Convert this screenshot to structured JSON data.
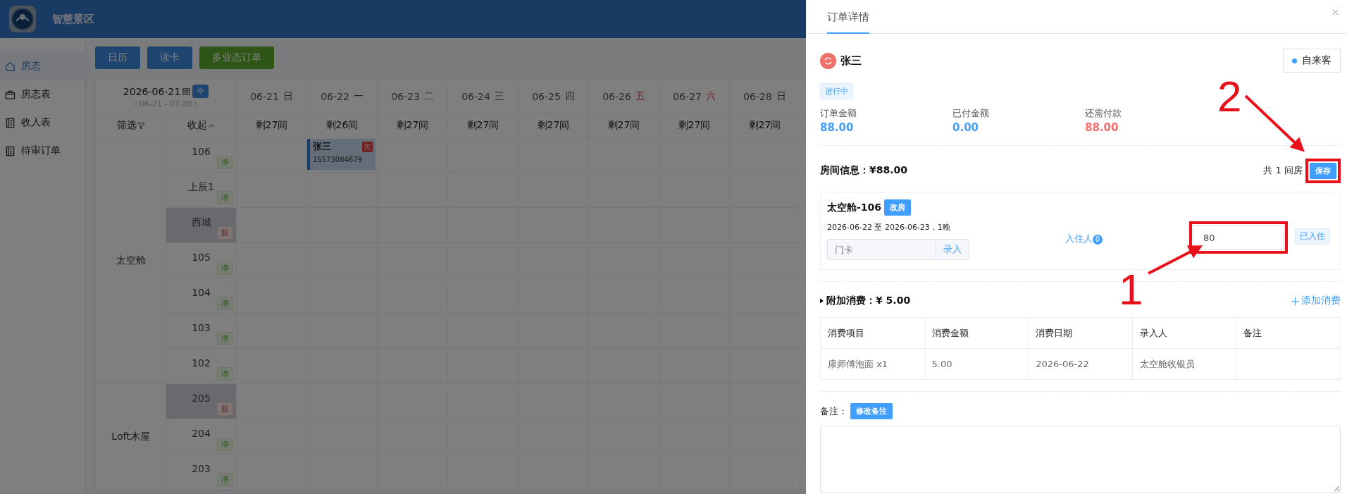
{
  "app": {
    "title": "智慧景区"
  },
  "sidebar": {
    "items": [
      {
        "label": "房态",
        "selected": true
      },
      {
        "label": "房态表",
        "selected": false
      },
      {
        "label": "收入表",
        "selected": false
      },
      {
        "label": "待审订单",
        "selected": false
      }
    ]
  },
  "toolbar": {
    "buttons": [
      {
        "label": "日历",
        "kind": "primary"
      },
      {
        "label": "读卡",
        "kind": "primary"
      },
      {
        "label": "多业态订单",
        "kind": "success"
      }
    ]
  },
  "calendar": {
    "date": "2026-06-21",
    "today_button": "今",
    "range": "06-21 - 07-20",
    "filter_label": "筛选",
    "collapse_label": "收起",
    "days": [
      {
        "date": "06-21",
        "weekday": "日",
        "highlight": false,
        "remaining": "剩27间"
      },
      {
        "date": "06-22",
        "weekday": "一",
        "highlight": false,
        "remaining": "剩26间"
      },
      {
        "date": "06-23",
        "weekday": "二",
        "highlight": false,
        "remaining": "剩27间"
      },
      {
        "date": "06-24",
        "weekday": "三",
        "highlight": false,
        "remaining": "剩27间"
      },
      {
        "date": "06-25",
        "weekday": "四",
        "highlight": false,
        "remaining": "剩27间"
      },
      {
        "date": "06-26",
        "weekday": "五",
        "highlight": true,
        "remaining": "剩27间"
      },
      {
        "date": "06-27",
        "weekday": "六",
        "highlight": true,
        "remaining": "剩27间"
      },
      {
        "date": "06-28",
        "weekday": "日",
        "highlight": false,
        "remaining": "剩27间"
      }
    ],
    "groups": [
      {
        "name": "太空舱",
        "rooms": [
          {
            "number": "106",
            "status": "净",
            "kind": "clean",
            "cells": [
              {
                "booked": false
              },
              {
                "booked": true,
                "name": "张三",
                "phone": "15573084679",
                "badge": "欠"
              },
              {
                "booked": false
              },
              {
                "booked": false
              },
              {
                "booked": false
              },
              {
                "booked": false
              },
              {
                "booked": false
              },
              {
                "booked": false
              }
            ]
          },
          {
            "number": "上辰1",
            "status": "净",
            "kind": "clean"
          },
          {
            "number": "西城",
            "status": "脏",
            "kind": "dirty"
          },
          {
            "number": "105",
            "status": "净",
            "kind": "clean"
          },
          {
            "number": "104",
            "status": "净",
            "kind": "clean"
          },
          {
            "number": "103",
            "status": "净",
            "kind": "clean"
          },
          {
            "number": "102",
            "status": "净",
            "kind": "clean"
          }
        ]
      },
      {
        "name": "Loft木屋",
        "rooms": [
          {
            "number": "205",
            "status": "脏",
            "kind": "dirty"
          },
          {
            "number": "204",
            "status": "净",
            "kind": "clean"
          },
          {
            "number": "203",
            "status": "净",
            "kind": "clean"
          }
        ]
      }
    ]
  },
  "drawer": {
    "tab": "订单详情",
    "guest_name": "张三",
    "source": "自来客",
    "status": "进行中",
    "amounts": [
      {
        "label": "订单金额",
        "value": "88.00",
        "kind": "total"
      },
      {
        "label": "已付金额",
        "value": "0.00",
        "kind": "paid"
      },
      {
        "label": "还需付款",
        "value": "88.00",
        "kind": "due"
      }
    ],
    "room_info": {
      "title": "房间信息：¥88.00",
      "count": "共 1 间房",
      "save_button": "保存"
    },
    "room": {
      "name": "太空舱-106",
      "change_button": "改房",
      "dates": "2026-06-22 至 2026-06-23，1晚",
      "guests_label": "入住人",
      "guests_count": "0",
      "price": "80",
      "status": "已入住",
      "card_placeholder": "门卡",
      "card_button": "录入"
    },
    "extras": {
      "title": "附加消费：¥ 5.00",
      "add_link": "添加消费",
      "columns": [
        "消费项目",
        "消费金额",
        "消费日期",
        "录入人",
        "备注"
      ],
      "rows": [
        [
          "康师傅泡面 x1",
          "5.00",
          "2026-06-22",
          "太空舱收银员"
        ]
      ]
    },
    "note": {
      "label": "备注：",
      "edit_button": "修改备注"
    }
  },
  "annotations": [
    {
      "label": "1"
    },
    {
      "label": "2"
    }
  ]
}
